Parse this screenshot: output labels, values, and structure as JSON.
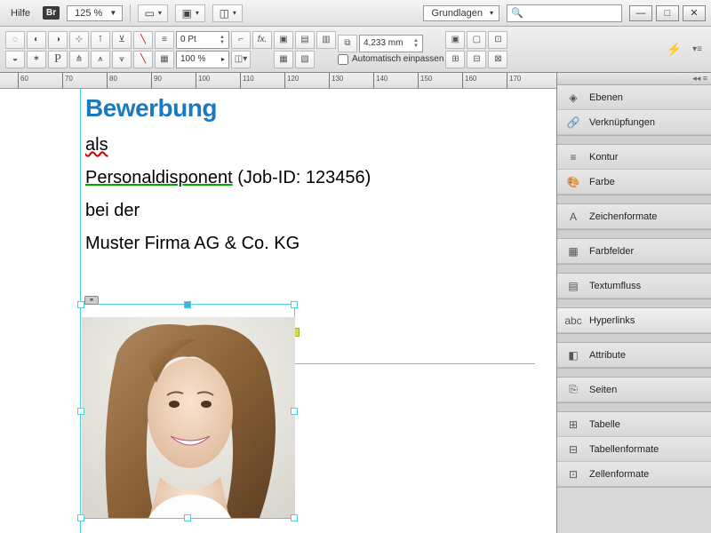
{
  "menubar": {
    "help": "Hilfe",
    "br": "Br",
    "zoom": "125 %",
    "workspace_label": "Grundlagen",
    "search_placeholder": ""
  },
  "toolbar": {
    "pt_value": "0 Pt",
    "pct_value": "100 %",
    "mm_value": "4,233 mm",
    "autofit_label": "Automatisch einpassen"
  },
  "ruler": {
    "ticks": [
      "60",
      "70",
      "80",
      "90",
      "100",
      "110",
      "120",
      "130",
      "140",
      "150",
      "160",
      "170"
    ]
  },
  "document": {
    "title": "Bewerbung",
    "line1_pre": "als",
    "line2_a": "Personaldisponent",
    "line2_b": " (Job-ID: 123456)",
    "line3": "bei der",
    "line4": "Muster Firma AG & Co. KG"
  },
  "panels": {
    "items": [
      {
        "icon": "◈",
        "label": "Ebenen"
      },
      {
        "icon": "🔗",
        "label": "Verknüpfungen"
      }
    ],
    "group2": [
      {
        "icon": "≡",
        "label": "Kontur"
      },
      {
        "icon": "🎨",
        "label": "Farbe"
      }
    ],
    "group3": [
      {
        "icon": "A",
        "label": "Zeichenformate"
      }
    ],
    "group4": [
      {
        "icon": "▦",
        "label": "Farbfelder"
      }
    ],
    "group5": [
      {
        "icon": "▤",
        "label": "Textumfluss"
      }
    ],
    "group6": [
      {
        "icon": "abc",
        "label": "Hyperlinks"
      }
    ],
    "group7": [
      {
        "icon": "◧",
        "label": "Attribute"
      }
    ],
    "group8": [
      {
        "icon": "⎘",
        "label": "Seiten"
      }
    ],
    "group9": [
      {
        "icon": "⊞",
        "label": "Tabelle"
      },
      {
        "icon": "⊟",
        "label": "Tabellenformate"
      },
      {
        "icon": "⊡",
        "label": "Zellenformate"
      }
    ]
  }
}
